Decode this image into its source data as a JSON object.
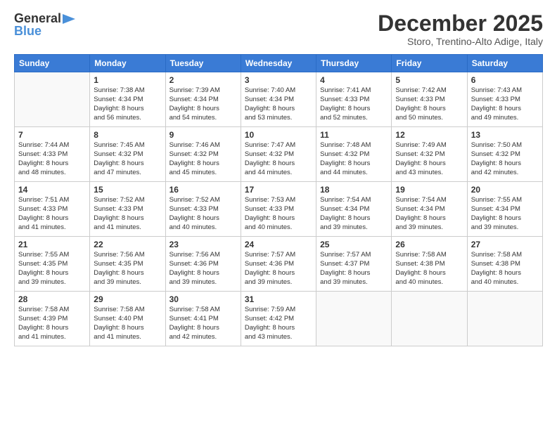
{
  "header": {
    "logo_line1": "General",
    "logo_line2": "Blue",
    "month_title": "December 2025",
    "subtitle": "Storo, Trentino-Alto Adige, Italy"
  },
  "days_of_week": [
    "Sunday",
    "Monday",
    "Tuesday",
    "Wednesday",
    "Thursday",
    "Friday",
    "Saturday"
  ],
  "weeks": [
    [
      {
        "day": "",
        "info": ""
      },
      {
        "day": "1",
        "info": "Sunrise: 7:38 AM\nSunset: 4:34 PM\nDaylight: 8 hours\nand 56 minutes."
      },
      {
        "day": "2",
        "info": "Sunrise: 7:39 AM\nSunset: 4:34 PM\nDaylight: 8 hours\nand 54 minutes."
      },
      {
        "day": "3",
        "info": "Sunrise: 7:40 AM\nSunset: 4:34 PM\nDaylight: 8 hours\nand 53 minutes."
      },
      {
        "day": "4",
        "info": "Sunrise: 7:41 AM\nSunset: 4:33 PM\nDaylight: 8 hours\nand 52 minutes."
      },
      {
        "day": "5",
        "info": "Sunrise: 7:42 AM\nSunset: 4:33 PM\nDaylight: 8 hours\nand 50 minutes."
      },
      {
        "day": "6",
        "info": "Sunrise: 7:43 AM\nSunset: 4:33 PM\nDaylight: 8 hours\nand 49 minutes."
      }
    ],
    [
      {
        "day": "7",
        "info": "Sunrise: 7:44 AM\nSunset: 4:33 PM\nDaylight: 8 hours\nand 48 minutes."
      },
      {
        "day": "8",
        "info": "Sunrise: 7:45 AM\nSunset: 4:32 PM\nDaylight: 8 hours\nand 47 minutes."
      },
      {
        "day": "9",
        "info": "Sunrise: 7:46 AM\nSunset: 4:32 PM\nDaylight: 8 hours\nand 45 minutes."
      },
      {
        "day": "10",
        "info": "Sunrise: 7:47 AM\nSunset: 4:32 PM\nDaylight: 8 hours\nand 44 minutes."
      },
      {
        "day": "11",
        "info": "Sunrise: 7:48 AM\nSunset: 4:32 PM\nDaylight: 8 hours\nand 44 minutes."
      },
      {
        "day": "12",
        "info": "Sunrise: 7:49 AM\nSunset: 4:32 PM\nDaylight: 8 hours\nand 43 minutes."
      },
      {
        "day": "13",
        "info": "Sunrise: 7:50 AM\nSunset: 4:32 PM\nDaylight: 8 hours\nand 42 minutes."
      }
    ],
    [
      {
        "day": "14",
        "info": "Sunrise: 7:51 AM\nSunset: 4:33 PM\nDaylight: 8 hours\nand 41 minutes."
      },
      {
        "day": "15",
        "info": "Sunrise: 7:52 AM\nSunset: 4:33 PM\nDaylight: 8 hours\nand 41 minutes."
      },
      {
        "day": "16",
        "info": "Sunrise: 7:52 AM\nSunset: 4:33 PM\nDaylight: 8 hours\nand 40 minutes."
      },
      {
        "day": "17",
        "info": "Sunrise: 7:53 AM\nSunset: 4:33 PM\nDaylight: 8 hours\nand 40 minutes."
      },
      {
        "day": "18",
        "info": "Sunrise: 7:54 AM\nSunset: 4:34 PM\nDaylight: 8 hours\nand 39 minutes."
      },
      {
        "day": "19",
        "info": "Sunrise: 7:54 AM\nSunset: 4:34 PM\nDaylight: 8 hours\nand 39 minutes."
      },
      {
        "day": "20",
        "info": "Sunrise: 7:55 AM\nSunset: 4:34 PM\nDaylight: 8 hours\nand 39 minutes."
      }
    ],
    [
      {
        "day": "21",
        "info": "Sunrise: 7:55 AM\nSunset: 4:35 PM\nDaylight: 8 hours\nand 39 minutes."
      },
      {
        "day": "22",
        "info": "Sunrise: 7:56 AM\nSunset: 4:35 PM\nDaylight: 8 hours\nand 39 minutes."
      },
      {
        "day": "23",
        "info": "Sunrise: 7:56 AM\nSunset: 4:36 PM\nDaylight: 8 hours\nand 39 minutes."
      },
      {
        "day": "24",
        "info": "Sunrise: 7:57 AM\nSunset: 4:36 PM\nDaylight: 8 hours\nand 39 minutes."
      },
      {
        "day": "25",
        "info": "Sunrise: 7:57 AM\nSunset: 4:37 PM\nDaylight: 8 hours\nand 39 minutes."
      },
      {
        "day": "26",
        "info": "Sunrise: 7:58 AM\nSunset: 4:38 PM\nDaylight: 8 hours\nand 40 minutes."
      },
      {
        "day": "27",
        "info": "Sunrise: 7:58 AM\nSunset: 4:38 PM\nDaylight: 8 hours\nand 40 minutes."
      }
    ],
    [
      {
        "day": "28",
        "info": "Sunrise: 7:58 AM\nSunset: 4:39 PM\nDaylight: 8 hours\nand 41 minutes."
      },
      {
        "day": "29",
        "info": "Sunrise: 7:58 AM\nSunset: 4:40 PM\nDaylight: 8 hours\nand 41 minutes."
      },
      {
        "day": "30",
        "info": "Sunrise: 7:58 AM\nSunset: 4:41 PM\nDaylight: 8 hours\nand 42 minutes."
      },
      {
        "day": "31",
        "info": "Sunrise: 7:59 AM\nSunset: 4:42 PM\nDaylight: 8 hours\nand 43 minutes."
      },
      {
        "day": "",
        "info": ""
      },
      {
        "day": "",
        "info": ""
      },
      {
        "day": "",
        "info": ""
      }
    ]
  ]
}
